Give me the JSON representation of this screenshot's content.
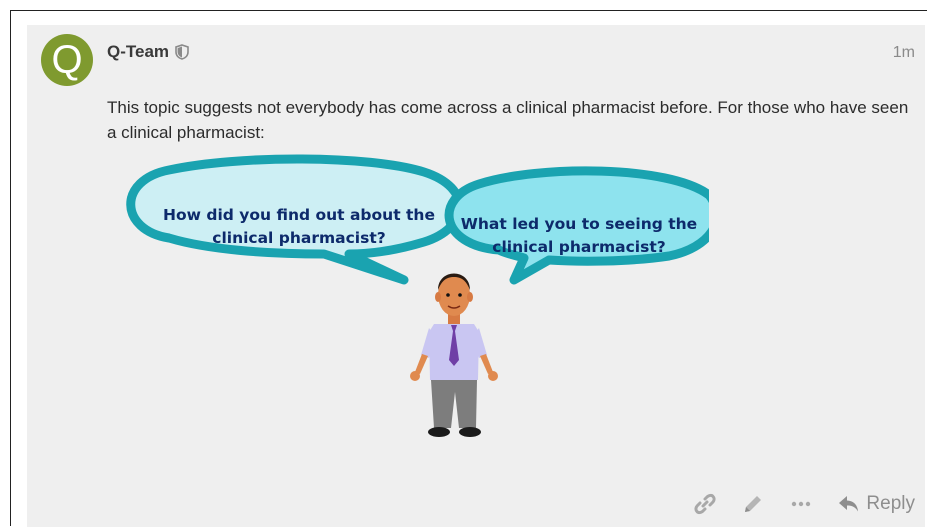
{
  "post": {
    "avatar_letter": "Q",
    "username": "Q-Team",
    "timestamp": "1m",
    "body": "This topic suggests not everybody has come across a clinical pharmacist before. For those who have seen a clinical pharmacist:",
    "illustration": {
      "bubble_left": {
        "line1": "How did you find out about the",
        "line2": "clinical pharmacist?"
      },
      "bubble_right": {
        "line1": "What led you to seeing the",
        "line2": "clinical pharmacist?"
      }
    },
    "actions": {
      "link_icon": "link-icon",
      "edit_icon": "pencil-icon",
      "more_icon": "ellipsis-icon",
      "reply_icon": "reply-arrow-icon",
      "reply_label": "Reply"
    }
  },
  "colors": {
    "avatar_bg": "#7f9a2f",
    "bubble_border": "#1aa3b0",
    "bubble_left_fill": "#cdeff4",
    "bubble_right_fill": "#8ee3ee",
    "bubble_text": "#0d2a6b",
    "post_bg": "#efefef"
  }
}
